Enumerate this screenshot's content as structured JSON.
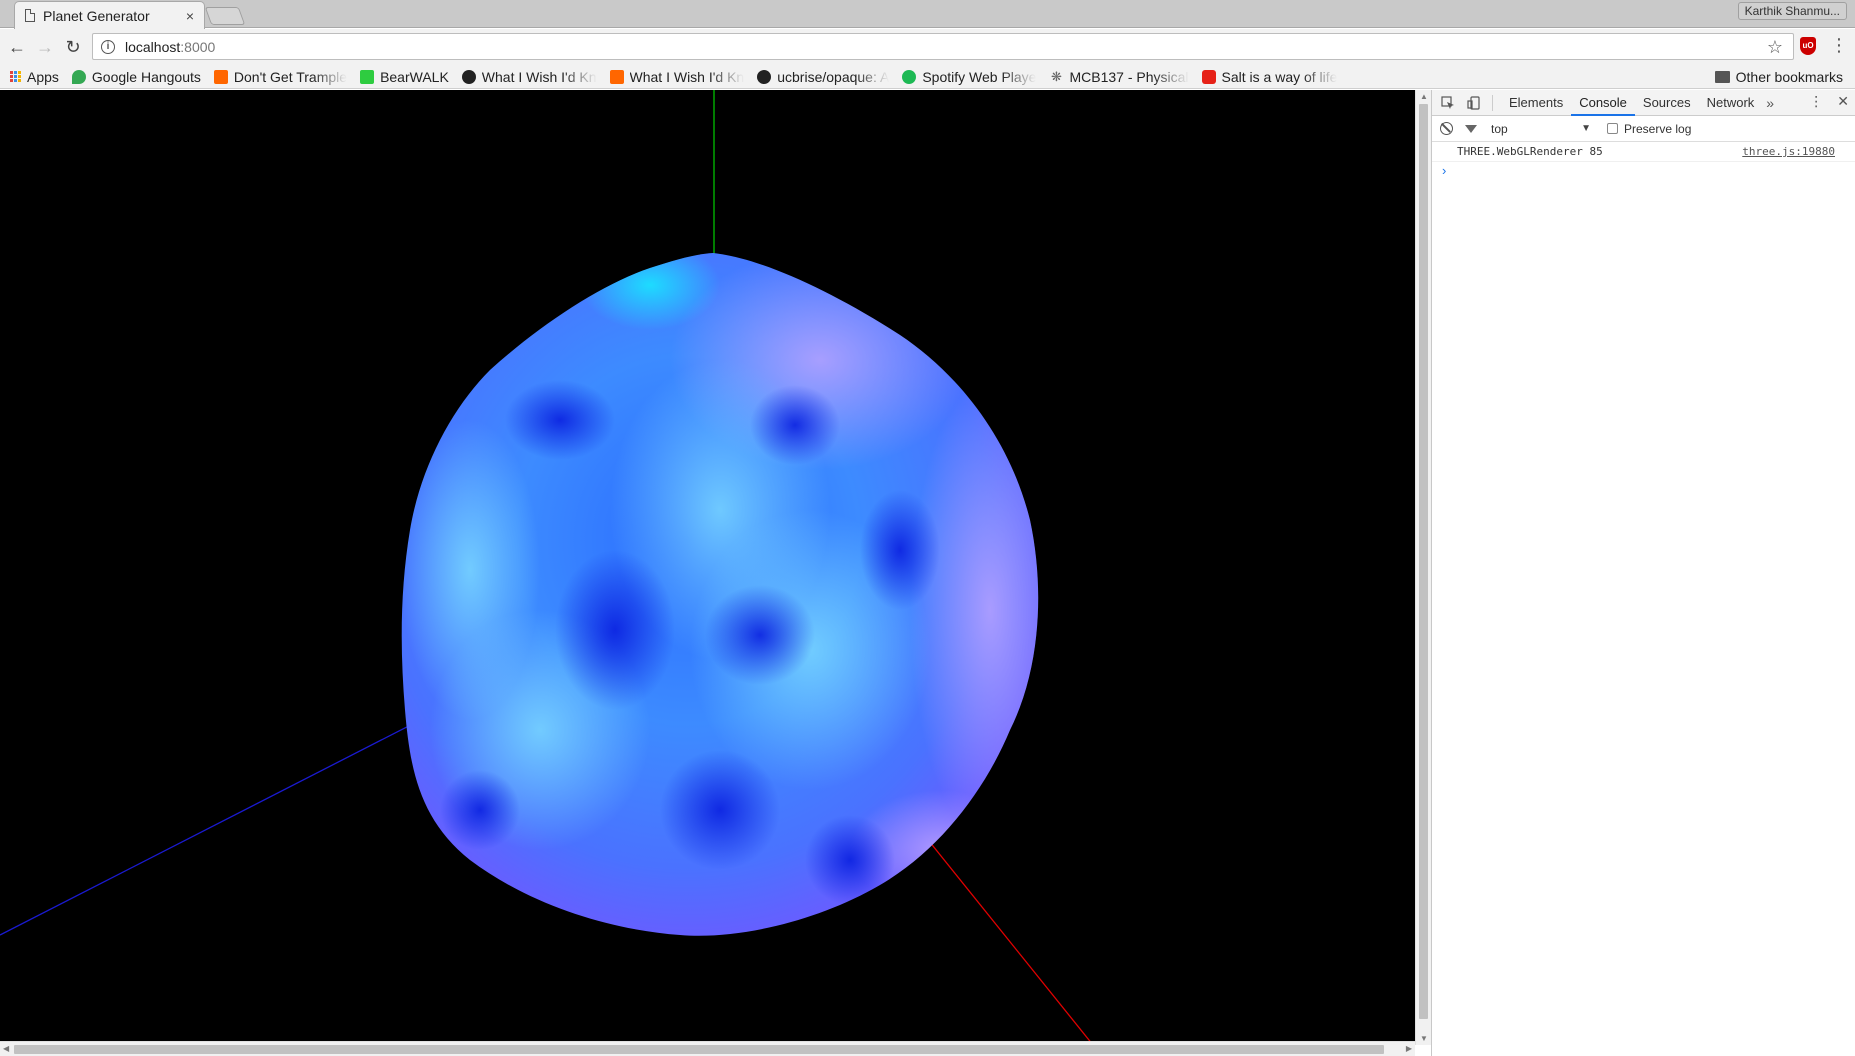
{
  "browser": {
    "tab": {
      "title": "Planet Generator",
      "close": "×"
    },
    "profile": "Karthik Shanmu...",
    "url": {
      "host": "localhost",
      "port": ":8000"
    }
  },
  "bookmarks": [
    {
      "label": "Apps",
      "icon": "apps-grid-icon"
    },
    {
      "label": "Google Hangouts",
      "icon": "hangouts-icon",
      "color": "#34a853"
    },
    {
      "label": "Don't Get Trample",
      "icon": "ycombinator-icon",
      "color": "#ff6600"
    },
    {
      "label": "BearWALK",
      "icon": "bearwalk-icon",
      "color": "#2ecc40"
    },
    {
      "label": "What I Wish I'd Kn",
      "icon": "github-icon",
      "color": "#222222"
    },
    {
      "label": "What I Wish I'd Kn",
      "icon": "ycombinator-icon",
      "color": "#ff6600"
    },
    {
      "label": "ucbrise/opaque: A",
      "icon": "github-icon",
      "color": "#222222"
    },
    {
      "label": "Spotify Web Playe",
      "icon": "spotify-icon",
      "color": "#1db954"
    },
    {
      "label": "MCB137 - Physical",
      "icon": "mcb-icon",
      "color": "#666666"
    },
    {
      "label": "Salt is a way of life",
      "icon": "youtube-icon",
      "color": "#e62117"
    }
  ],
  "other_bookmarks": "Other bookmarks",
  "devtools": {
    "tabs": [
      "Elements",
      "Console",
      "Sources",
      "Network"
    ],
    "active_tab": "Console",
    "more": "»",
    "context": "top",
    "preserve_log": "Preserve log",
    "log": [
      {
        "message": "THREE.WebGLRenderer 85",
        "source": "three.js:19880"
      }
    ],
    "prompt": "›"
  },
  "scene": {
    "background": "#000000",
    "axes": {
      "x": "#ff0000",
      "y": "#00cc00",
      "z": "#0000ff"
    },
    "planet_colors": [
      "#0a2cf0",
      "#2f7dff",
      "#5fc8ff",
      "#8a85ff",
      "#b89cff"
    ]
  }
}
